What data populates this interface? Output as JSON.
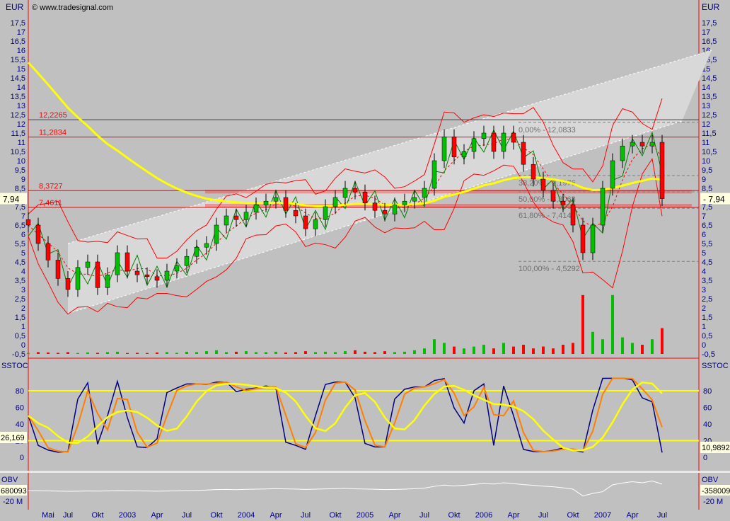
{
  "chart_data": {
    "type": "candlestick",
    "currency": "EUR",
    "watermark": "© www.tradesignal.com",
    "price_axis": {
      "min": -0.5,
      "max": 17.5,
      "step": 0.5
    },
    "x_ticks": [
      {
        "label": "Mai",
        "m": 4
      },
      {
        "label": "Jul",
        "m": 6
      },
      {
        "label": "Okt",
        "m": 9
      },
      {
        "label": "2003",
        "m": 12
      },
      {
        "label": "Apr",
        "m": 15
      },
      {
        "label": "Jul",
        "m": 18
      },
      {
        "label": "Okt",
        "m": 21
      },
      {
        "label": "2004",
        "m": 24
      },
      {
        "label": "Apr",
        "m": 27
      },
      {
        "label": "Jul",
        "m": 30
      },
      {
        "label": "Okt",
        "m": 33
      },
      {
        "label": "2005",
        "m": 36
      },
      {
        "label": "Apr",
        "m": 39
      },
      {
        "label": "Jul",
        "m": 42
      },
      {
        "label": "Okt",
        "m": 45
      },
      {
        "label": "2006",
        "m": 48
      },
      {
        "label": "Apr",
        "m": 51
      },
      {
        "label": "Jul",
        "m": 54
      },
      {
        "label": "Okt",
        "m": 57
      },
      {
        "label": "2007",
        "m": 60
      },
      {
        "label": "Apr",
        "m": 63
      },
      {
        "label": "Jul",
        "m": 66
      }
    ],
    "start_month": "2002-03",
    "closes": [
      6.5,
      5.5,
      4.6,
      3.6,
      3.0,
      4.2,
      4.5,
      3.1,
      3.8,
      5.0,
      4.0,
      3.8,
      3.7,
      3.5,
      4.0,
      4.3,
      4.8,
      5.3,
      5.5,
      6.5,
      7.0,
      6.8,
      7.2,
      7.6,
      7.8,
      8.0,
      7.3,
      7.0,
      6.3,
      6.8,
      7.5,
      8.0,
      8.5,
      8.3,
      7.7,
      7.3,
      7.1,
      7.6,
      7.8,
      8.0,
      8.5,
      10.0,
      11.3,
      10.2,
      10.5,
      11.2,
      11.5,
      10.5,
      11.5,
      11.0,
      9.8,
      9.0,
      8.4,
      7.8,
      7.6,
      6.5,
      5.0,
      6.5,
      8.5,
      10.0,
      10.8,
      11.0,
      10.8,
      11.0,
      7.94
    ],
    "volume": [
      0.05,
      0.1,
      0.08,
      0.06,
      0.1,
      0.05,
      0.08,
      0.06,
      0.1,
      0.12,
      0.05,
      0.06,
      0.05,
      0.08,
      0.1,
      0.06,
      0.12,
      0.1,
      0.15,
      0.2,
      0.1,
      0.12,
      0.15,
      0.1,
      0.1,
      0.12,
      0.08,
      0.1,
      0.15,
      0.1,
      0.12,
      0.1,
      0.15,
      0.2,
      0.12,
      0.1,
      0.15,
      0.1,
      0.12,
      0.2,
      0.3,
      0.8,
      0.6,
      0.4,
      0.3,
      0.4,
      0.5,
      0.3,
      0.6,
      0.4,
      0.5,
      0.3,
      0.4,
      0.3,
      0.5,
      0.6,
      3.2,
      1.2,
      0.8,
      3.2,
      0.9,
      0.6,
      0.5,
      0.8,
      1.4
    ],
    "sma_start": 15.9,
    "hlines": [
      {
        "label": "12,2265",
        "value": 12.2265,
        "color": "#404040"
      },
      {
        "label": "11,2834",
        "value": 11.2834,
        "color": "#ff0000"
      },
      {
        "label": "8,3727",
        "value": 8.3727,
        "color": "#ff0000"
      },
      {
        "label": "7,4611",
        "value": 7.4611,
        "color": "#ff0000"
      }
    ],
    "fibonacci": [
      {
        "label": "0,00% - 12,0833",
        "value": 12.0833
      },
      {
        "label": "38,20% - 9,1976",
        "value": 9.1976
      },
      {
        "label": "50,00% - 8,3063",
        "value": 8.3063
      },
      {
        "label": "61,80% - 7,4149",
        "value": 7.4149
      },
      {
        "label": "100,00% - 4,5292",
        "value": 4.5292
      }
    ],
    "channel": {
      "lower": [
        [
          6,
          1.7
        ],
        [
          68,
          12.15
        ]
      ],
      "upper": [
        [
          6,
          5.5
        ],
        [
          71,
          16.0
        ]
      ]
    },
    "last_price": "7,94",
    "stoch": {
      "label": "SSTOC",
      "ticks": [
        0,
        20,
        40,
        60,
        80
      ],
      "levels": [
        20,
        80
      ],
      "left_value": "26,169",
      "right_value": "10,9892"
    },
    "obv": {
      "label": "OBV",
      "tick": "-20 M",
      "left_value": "680093",
      "right_value": "-358009"
    },
    "colors": {
      "up": "#00c000",
      "down": "#ff0000",
      "sma": "#ffff00",
      "axis": "#000080",
      "stoch_fast": "#000080",
      "stoch_slow": "#ff8000",
      "stoch_long": "#ffff00"
    }
  }
}
